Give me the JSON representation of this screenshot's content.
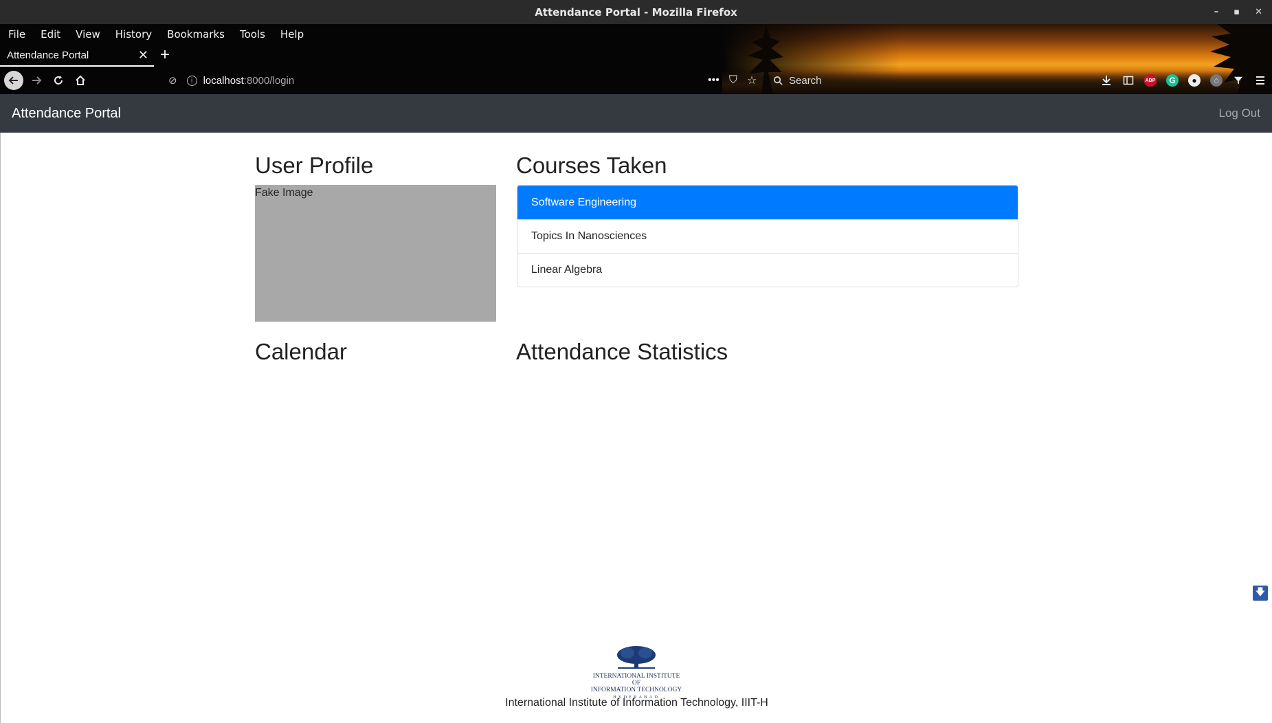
{
  "window": {
    "title": "Attendance Portal - Mozilla Firefox",
    "controls": {
      "minimize": "–",
      "maximize": "▪",
      "close": "✕"
    }
  },
  "browser": {
    "menu": [
      "File",
      "Edit",
      "View",
      "History",
      "Bookmarks",
      "Tools",
      "Help"
    ],
    "tab": {
      "title": "Attendance Portal",
      "close": "✕"
    },
    "new_tab": "+",
    "url": {
      "host": "localhost",
      "path": ":8000/login"
    },
    "search": {
      "placeholder": "Search"
    },
    "page_actions": {
      "more": "•••",
      "pocket": "⛉",
      "bookmark": "☆"
    },
    "extensions": {
      "abp": "ABP",
      "grammarly": "G",
      "account": "●",
      "privacy": "⌂"
    },
    "icons": {
      "back": "back-arrow-icon",
      "forward": "forward-arrow-icon",
      "reload": "reload-icon",
      "home": "home-icon",
      "tracking": "tracking-protection-icon",
      "info": "site-info-icon",
      "search": "search-icon",
      "downloads": "download-icon",
      "sidebar": "sidebar-icon",
      "menu": "hamburger-menu-icon"
    }
  },
  "app": {
    "brand": "Attendance Portal",
    "logout": "Log Out",
    "navbar_color": "#343a40",
    "accent_color": "#007bff",
    "sections": {
      "profile": "User Profile",
      "courses": "Courses Taken",
      "calendar": "Calendar",
      "stats": "Attendance Statistics"
    },
    "profile_image_text": "Fake Image",
    "courses": [
      {
        "name": "Software Engineering",
        "active": true
      },
      {
        "name": "Topics In Nanosciences",
        "active": false
      },
      {
        "name": "Linear Algebra",
        "active": false
      }
    ],
    "footer": {
      "logo_line1": "INTERNATIONAL INSTITUTE OF",
      "logo_line2": "INFORMATION TECHNOLOGY",
      "logo_line3": "HYDERABAD",
      "text": "International Institute of Information Technology, IIIT-H"
    }
  }
}
